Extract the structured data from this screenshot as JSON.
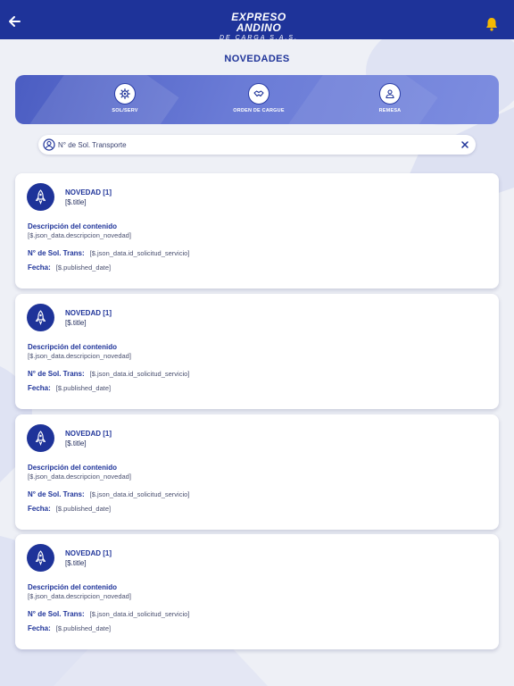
{
  "header": {
    "logo_line1": "EXPRESO ANDINO",
    "logo_line2": "DE CARGA S.A.S.",
    "title": "NOVEDADES"
  },
  "quick_actions": [
    {
      "label": "SOL/SERV",
      "icon": "gear-icon"
    },
    {
      "label": "ORDEN DE CARGUE",
      "icon": "handshake-icon"
    },
    {
      "label": "REMESA",
      "icon": "person-icon"
    }
  ],
  "search": {
    "placeholder": "N° de Sol. Transporte",
    "value": ""
  },
  "cards": [
    {
      "title": "NOVEDAD [1]",
      "subtitle": "[$.title]",
      "desc_label": "Descripción del contenido",
      "desc_value": "[$.json_data.descripcion_novedad]",
      "sol_label": "N° de Sol. Trans:",
      "sol_value": "[$.json_data.id_solicitud_servicio]",
      "fecha_label": "Fecha:",
      "fecha_value": "[$.published_date]"
    },
    {
      "title": "NOVEDAD [1]",
      "subtitle": "[$.title]",
      "desc_label": "Descripción del contenido",
      "desc_value": "[$.json_data.descripcion_novedad]",
      "sol_label": "N° de Sol. Trans:",
      "sol_value": "[$.json_data.id_solicitud_servicio]",
      "fecha_label": "Fecha:",
      "fecha_value": "[$.published_date]"
    },
    {
      "title": "NOVEDAD [1]",
      "subtitle": "[$.title]",
      "desc_label": "Descripción del contenido",
      "desc_value": "[$.json_data.descripcion_novedad]",
      "sol_label": "N° de Sol. Trans:",
      "sol_value": "[$.json_data.id_solicitud_servicio]",
      "fecha_label": "Fecha:",
      "fecha_value": "[$.published_date]"
    },
    {
      "title": "NOVEDAD [1]",
      "subtitle": "[$.title]",
      "desc_label": "Descripción del contenido",
      "desc_value": "[$.json_data.descripcion_novedad]",
      "sol_label": "N° de Sol. Trans:",
      "sol_value": "[$.json_data.id_solicitud_servicio]",
      "fecha_label": "Fecha:",
      "fecha_value": "[$.published_date]"
    }
  ],
  "colors": {
    "brand_blue": "#1e3399",
    "accent_bell": "#f5b800",
    "background": "#eef0f6"
  }
}
